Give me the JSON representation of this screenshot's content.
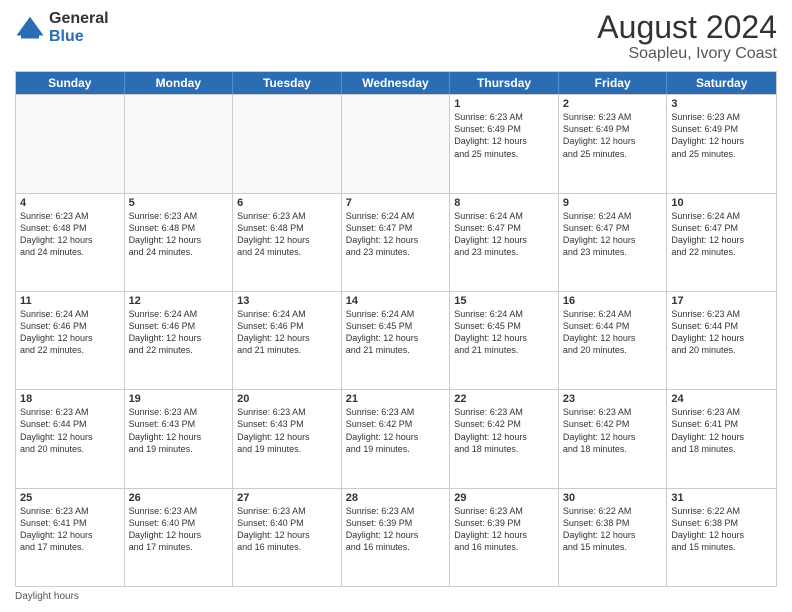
{
  "header": {
    "logo_general": "General",
    "logo_blue": "Blue",
    "title": "August 2024",
    "subtitle": "Soapleu, Ivory Coast"
  },
  "days_of_week": [
    "Sunday",
    "Monday",
    "Tuesday",
    "Wednesday",
    "Thursday",
    "Friday",
    "Saturday"
  ],
  "weeks": [
    [
      {
        "day": "",
        "info": "",
        "empty": true
      },
      {
        "day": "",
        "info": "",
        "empty": true
      },
      {
        "day": "",
        "info": "",
        "empty": true
      },
      {
        "day": "",
        "info": "",
        "empty": true
      },
      {
        "day": "1",
        "info": "Sunrise: 6:23 AM\nSunset: 6:49 PM\nDaylight: 12 hours\nand 25 minutes."
      },
      {
        "day": "2",
        "info": "Sunrise: 6:23 AM\nSunset: 6:49 PM\nDaylight: 12 hours\nand 25 minutes."
      },
      {
        "day": "3",
        "info": "Sunrise: 6:23 AM\nSunset: 6:49 PM\nDaylight: 12 hours\nand 25 minutes."
      }
    ],
    [
      {
        "day": "4",
        "info": "Sunrise: 6:23 AM\nSunset: 6:48 PM\nDaylight: 12 hours\nand 24 minutes."
      },
      {
        "day": "5",
        "info": "Sunrise: 6:23 AM\nSunset: 6:48 PM\nDaylight: 12 hours\nand 24 minutes."
      },
      {
        "day": "6",
        "info": "Sunrise: 6:23 AM\nSunset: 6:48 PM\nDaylight: 12 hours\nand 24 minutes."
      },
      {
        "day": "7",
        "info": "Sunrise: 6:24 AM\nSunset: 6:47 PM\nDaylight: 12 hours\nand 23 minutes."
      },
      {
        "day": "8",
        "info": "Sunrise: 6:24 AM\nSunset: 6:47 PM\nDaylight: 12 hours\nand 23 minutes."
      },
      {
        "day": "9",
        "info": "Sunrise: 6:24 AM\nSunset: 6:47 PM\nDaylight: 12 hours\nand 23 minutes."
      },
      {
        "day": "10",
        "info": "Sunrise: 6:24 AM\nSunset: 6:47 PM\nDaylight: 12 hours\nand 22 minutes."
      }
    ],
    [
      {
        "day": "11",
        "info": "Sunrise: 6:24 AM\nSunset: 6:46 PM\nDaylight: 12 hours\nand 22 minutes."
      },
      {
        "day": "12",
        "info": "Sunrise: 6:24 AM\nSunset: 6:46 PM\nDaylight: 12 hours\nand 22 minutes."
      },
      {
        "day": "13",
        "info": "Sunrise: 6:24 AM\nSunset: 6:46 PM\nDaylight: 12 hours\nand 21 minutes."
      },
      {
        "day": "14",
        "info": "Sunrise: 6:24 AM\nSunset: 6:45 PM\nDaylight: 12 hours\nand 21 minutes."
      },
      {
        "day": "15",
        "info": "Sunrise: 6:24 AM\nSunset: 6:45 PM\nDaylight: 12 hours\nand 21 minutes."
      },
      {
        "day": "16",
        "info": "Sunrise: 6:24 AM\nSunset: 6:44 PM\nDaylight: 12 hours\nand 20 minutes."
      },
      {
        "day": "17",
        "info": "Sunrise: 6:23 AM\nSunset: 6:44 PM\nDaylight: 12 hours\nand 20 minutes."
      }
    ],
    [
      {
        "day": "18",
        "info": "Sunrise: 6:23 AM\nSunset: 6:44 PM\nDaylight: 12 hours\nand 20 minutes."
      },
      {
        "day": "19",
        "info": "Sunrise: 6:23 AM\nSunset: 6:43 PM\nDaylight: 12 hours\nand 19 minutes."
      },
      {
        "day": "20",
        "info": "Sunrise: 6:23 AM\nSunset: 6:43 PM\nDaylight: 12 hours\nand 19 minutes."
      },
      {
        "day": "21",
        "info": "Sunrise: 6:23 AM\nSunset: 6:42 PM\nDaylight: 12 hours\nand 19 minutes."
      },
      {
        "day": "22",
        "info": "Sunrise: 6:23 AM\nSunset: 6:42 PM\nDaylight: 12 hours\nand 18 minutes."
      },
      {
        "day": "23",
        "info": "Sunrise: 6:23 AM\nSunset: 6:42 PM\nDaylight: 12 hours\nand 18 minutes."
      },
      {
        "day": "24",
        "info": "Sunrise: 6:23 AM\nSunset: 6:41 PM\nDaylight: 12 hours\nand 18 minutes."
      }
    ],
    [
      {
        "day": "25",
        "info": "Sunrise: 6:23 AM\nSunset: 6:41 PM\nDaylight: 12 hours\nand 17 minutes."
      },
      {
        "day": "26",
        "info": "Sunrise: 6:23 AM\nSunset: 6:40 PM\nDaylight: 12 hours\nand 17 minutes."
      },
      {
        "day": "27",
        "info": "Sunrise: 6:23 AM\nSunset: 6:40 PM\nDaylight: 12 hours\nand 16 minutes."
      },
      {
        "day": "28",
        "info": "Sunrise: 6:23 AM\nSunset: 6:39 PM\nDaylight: 12 hours\nand 16 minutes."
      },
      {
        "day": "29",
        "info": "Sunrise: 6:23 AM\nSunset: 6:39 PM\nDaylight: 12 hours\nand 16 minutes."
      },
      {
        "day": "30",
        "info": "Sunrise: 6:22 AM\nSunset: 6:38 PM\nDaylight: 12 hours\nand 15 minutes."
      },
      {
        "day": "31",
        "info": "Sunrise: 6:22 AM\nSunset: 6:38 PM\nDaylight: 12 hours\nand 15 minutes."
      }
    ]
  ],
  "footer": {
    "note": "Daylight hours"
  }
}
